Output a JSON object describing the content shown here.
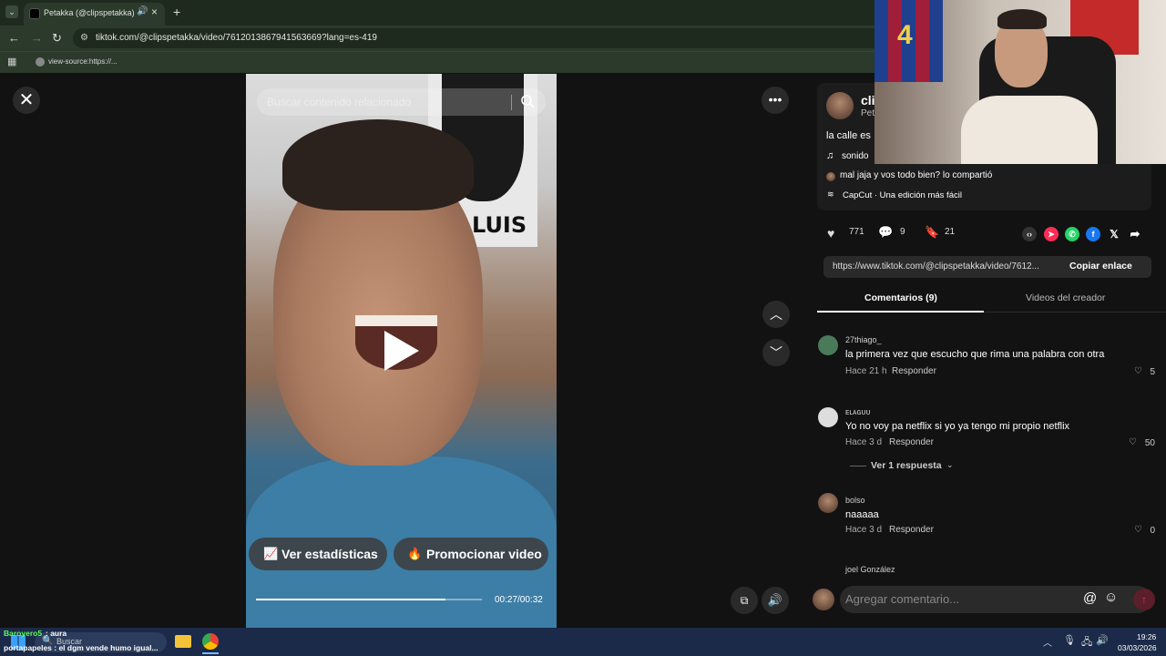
{
  "browser": {
    "tab_title": "Petakka (@clipspetakka) | T",
    "url": "tiktok.com/@clipspetakka/video/7612013867941563669?lang=es-419",
    "bookmark": "view-source:https://..."
  },
  "video": {
    "search_placeholder": "Buscar contenido relacionado",
    "poster_text": "LUIS",
    "stats_button": "Ver estadísticas",
    "promote_button": "Promocionar video",
    "timecode": "00:27/00:32",
    "progress": 0.84
  },
  "panel": {
    "author_short": "cli",
    "author_sub": "Pet",
    "caption": "la calle es",
    "sound": "sonido",
    "shared_by": "mal jaja y vos todo bien? lo compartió",
    "capcut": "CapCut · Una edición más fácil",
    "likes": "771",
    "comments_count": "9",
    "saves": "21",
    "link": "https://www.tiktok.com/@clipspetakka/video/7612...",
    "copy_link": "Copiar enlace",
    "tab_comments": "Comentarios (9)",
    "tab_creator": "Videos del creador",
    "reply_label": "Responder",
    "comments": [
      {
        "user": "27thiago_",
        "text": "la primera vez que escucho que rima una palabra con otra",
        "time": "Hace 21 h",
        "likes": "5"
      },
      {
        "user": "ᴇʟᴀɢᴜᴜ",
        "text": "Yo no voy pa netflix si yo ya tengo mi propio netflix",
        "time": "Hace 3 d",
        "likes": "50"
      },
      {
        "user": "bolso",
        "text": "naaaaa",
        "time": "Hace 3 d",
        "likes": "0"
      },
      {
        "user": "joel González"
      }
    ],
    "view_replies": "Ver 1 respuesta",
    "composer_placeholder": "Agregar comentario..."
  },
  "taskbar": {
    "chat_user": "Baroyero5",
    "chat_msg": ": aura",
    "chat_line2": "portapapeles : el dgm vende humo igual...",
    "search": "Buscar",
    "time": "19:26",
    "date": "03/03/2026"
  },
  "colors": {
    "bg": "#121212",
    "accent_red": "#fe2c55",
    "taskbar": "#1b2a48"
  }
}
